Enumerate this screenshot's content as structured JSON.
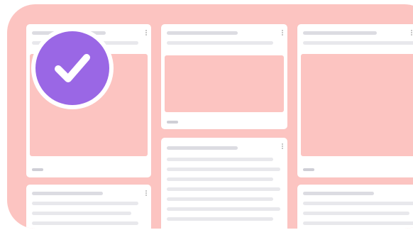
{
  "board": {
    "background_color": "#fcc4c1",
    "columns": [
      {
        "cards": [
          {
            "has_image": true,
            "footer": ""
          },
          {
            "has_image": false,
            "footer": ""
          }
        ]
      },
      {
        "cards": [
          {
            "has_image": true,
            "footer": ""
          },
          {
            "has_image": false,
            "footer": ""
          }
        ]
      },
      {
        "cards": [
          {
            "has_image": true,
            "footer": ""
          },
          {
            "has_image": false,
            "footer": ""
          }
        ]
      }
    ]
  },
  "selection": {
    "icon": "checkmark-icon",
    "color": "#9a67e5",
    "state": "selected"
  }
}
